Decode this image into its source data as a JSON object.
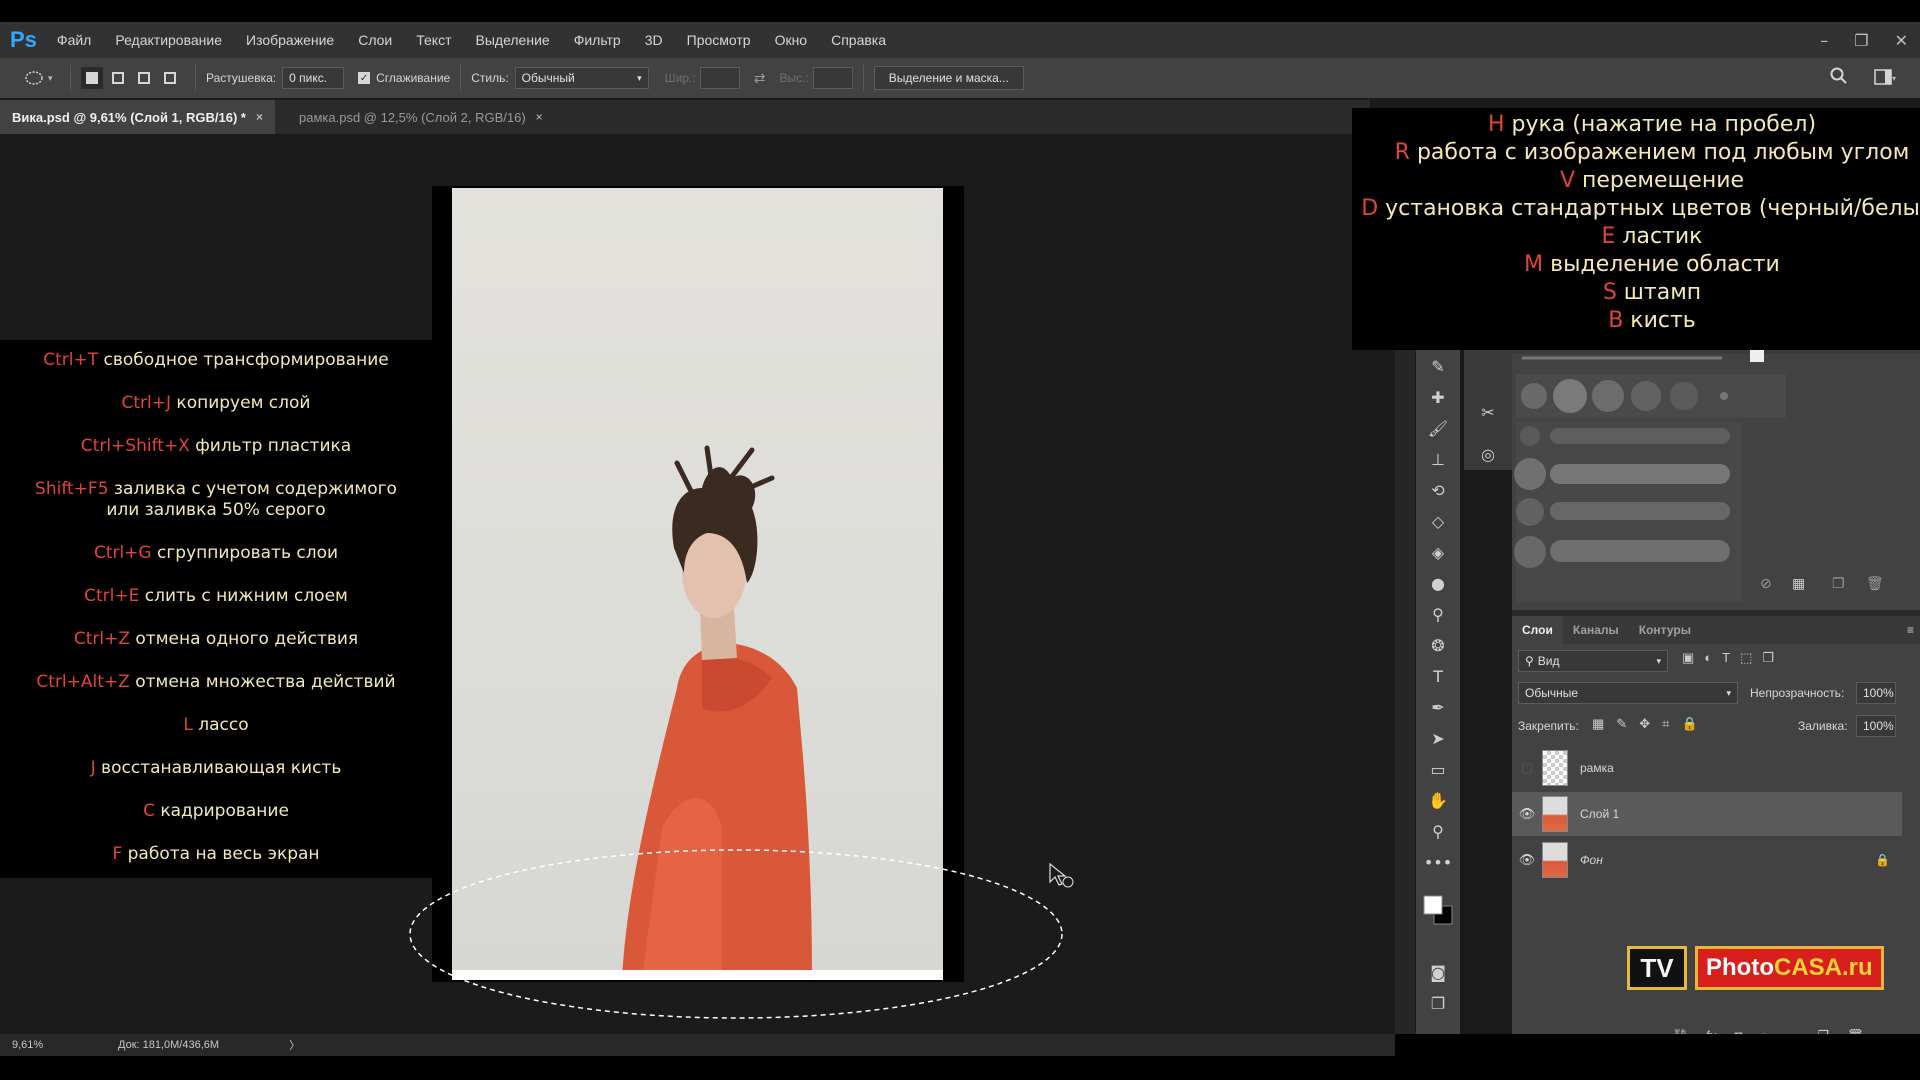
{
  "app": {
    "logo": "Ps"
  },
  "menu": [
    "Файл",
    "Редактирование",
    "Изображение",
    "Слои",
    "Текст",
    "Выделение",
    "Фильтр",
    "3D",
    "Просмотр",
    "Окно",
    "Справка"
  ],
  "options": {
    "feather_label": "Растушевка:",
    "feather_value": "0 пикс.",
    "antialias_label": "Сглаживание",
    "style_label": "Стиль:",
    "style_value": "Обычный",
    "width_label": "Шир.:",
    "height_label": "Выс.:",
    "mask_button": "Выделение и маска..."
  },
  "tabs": [
    {
      "label": "Вика.psd @ 9,61% (Слой 1, RGB/16) *",
      "close": "×"
    },
    {
      "label": "рамка.psd @ 12,5% (Слой 2, RGB/16)",
      "close": "×"
    }
  ],
  "shortcuts": [
    {
      "key": "Ctrl+T",
      "text": " свободное трансформирование"
    },
    {
      "key": "Ctrl+J",
      "text": " копируем слой"
    },
    {
      "key": "Ctrl+Shift+X",
      "text": " фильтр пластика"
    },
    {
      "key": "Shift+F5",
      "text": " заливка с учетом содержимого",
      "text2": "или  заливка 50% серого"
    },
    {
      "key": "Ctrl+G",
      "text": " сгруппировать слои"
    },
    {
      "key": "Ctrl+E",
      "text": " слить с нижним слоем"
    },
    {
      "key": "Ctrl+Z",
      "text": " отмена одного действия"
    },
    {
      "key": "Ctrl+Alt+Z",
      "text": " отмена множества действий"
    },
    {
      "key": "L",
      "text": " лассо"
    },
    {
      "key": "J",
      "text": " восстанавливающая кисть"
    },
    {
      "key": "C",
      "text": " кадрирование"
    },
    {
      "key": "F",
      "text": " работа на весь экран"
    }
  ],
  "keys": [
    {
      "key": "H",
      "text": " рука (нажатие на пробел)"
    },
    {
      "key": "R",
      "text": " работа с изображением под любым углом"
    },
    {
      "key": "V",
      "text": " перемещение"
    },
    {
      "key": "D",
      "text": " установка стандартных цветов (черный/белый)"
    },
    {
      "key": "E",
      "text": " ластик"
    },
    {
      "key": "M",
      "text": " выделение области"
    },
    {
      "key": "S",
      "text": " штамп"
    },
    {
      "key": "B",
      "text": " кисть"
    }
  ],
  "layers_panel": {
    "tabs": [
      "Слои",
      "Каналы",
      "Контуры"
    ],
    "filter_value": "Вид",
    "blend_mode": "Обычные",
    "opacity_label": "Непрозрачность:",
    "opacity_value": "100%",
    "lock_label": "Закрепить:",
    "fill_label": "Заливка:",
    "fill_value": "100%",
    "layers": [
      {
        "name": "рамка",
        "visible": false,
        "selected": false
      },
      {
        "name": "Слой 1",
        "visible": true,
        "selected": true
      },
      {
        "name": "Фон",
        "visible": true,
        "selected": false,
        "locked": true
      }
    ]
  },
  "status": {
    "zoom": "9,61%",
    "doc": "Док: 181,0M/436,6M"
  },
  "logo": {
    "tv": "TV",
    "photo": "Photo",
    "casa": "CASA.ru"
  },
  "colors": {
    "accent": "#31a8ff",
    "shortcut_key": "#e0443a",
    "shortcut_text": "#f4e9b5"
  }
}
